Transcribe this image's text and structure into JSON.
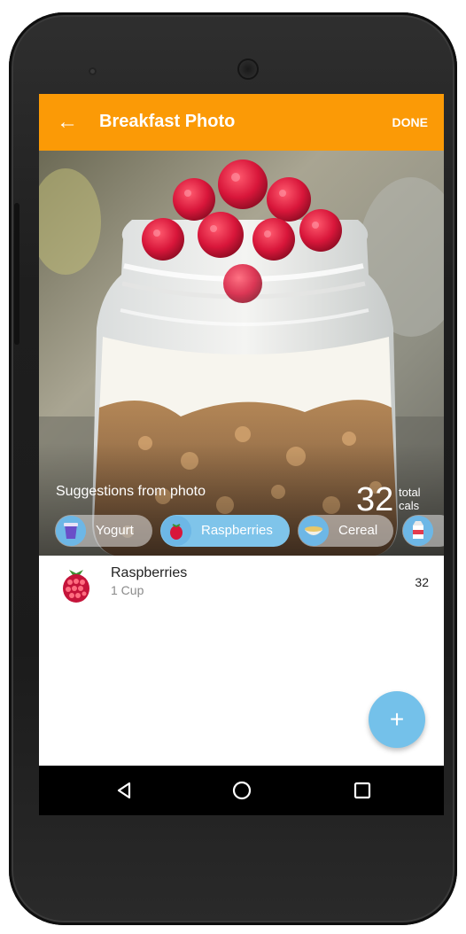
{
  "appbar": {
    "title": "Breakfast Photo",
    "done_label": "DONE",
    "back_icon": "arrow-left-icon",
    "color": "#fb9a06"
  },
  "photo": {
    "total_cals_value": "32",
    "total_cals_line1": "total",
    "total_cals_line2": "cals",
    "suggestions_label": "Suggestions from photo"
  },
  "chips": [
    {
      "label": "Yogurt",
      "icon": "yogurt-icon",
      "selected": false
    },
    {
      "label": "Raspberries",
      "icon": "raspberry-icon",
      "selected": true
    },
    {
      "label": "Cereal",
      "icon": "cereal-icon",
      "selected": false
    },
    {
      "label": "",
      "icon": "milk-carton-icon",
      "selected": false
    }
  ],
  "food_list": [
    {
      "name": "Raspberries",
      "quantity": "1 Cup",
      "calories": "32",
      "icon": "raspberry-icon"
    }
  ],
  "fab": {
    "icon": "plus-icon",
    "label": "+",
    "color": "#74c1ea"
  },
  "navbar": {
    "back": "triangle-back-icon",
    "home": "circle-home-icon",
    "recents": "square-recents-icon"
  }
}
